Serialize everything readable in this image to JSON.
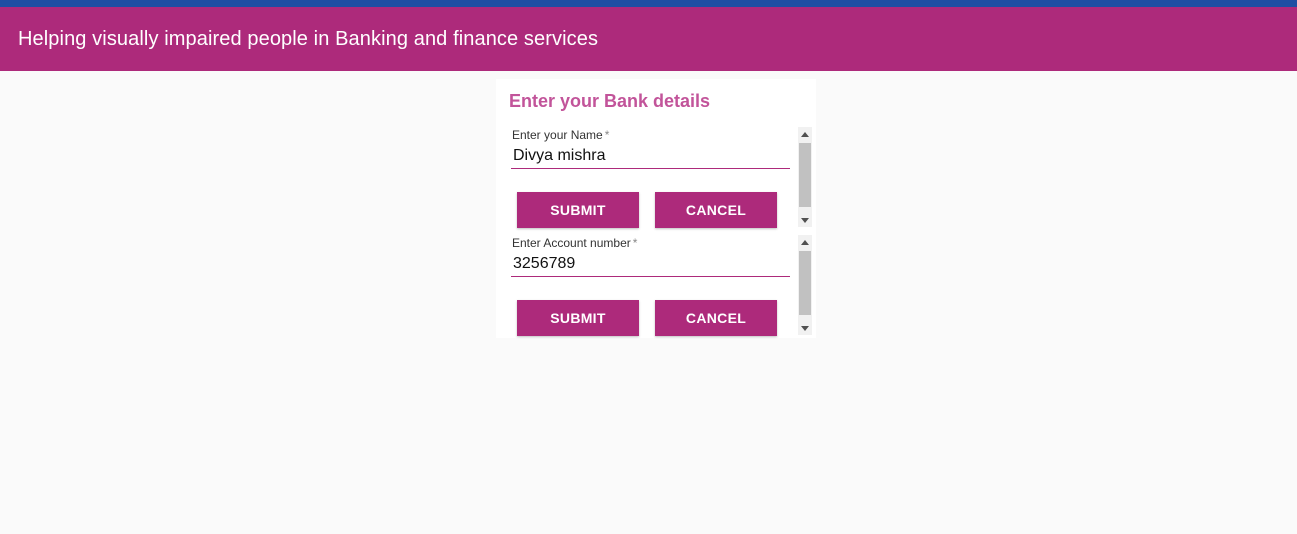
{
  "app": {
    "title": "Helping visually impaired people in Banking and finance services"
  },
  "form": {
    "heading": "Enter your Bank details",
    "name_field": {
      "label": "Enter your Name",
      "required_mark": "*",
      "value": "Divya mishra",
      "submit_label": "SUBMIT",
      "cancel_label": "CANCEL"
    },
    "account_field": {
      "label": "Enter Account number",
      "required_mark": "*",
      "value": "3256789",
      "submit_label": "SUBMIT",
      "cancel_label": "CANCEL"
    }
  },
  "icons": {
    "scroll_up": "triangle-up-icon",
    "scroll_down": "triangle-down-icon"
  },
  "colors": {
    "brand": "#ad2a7b",
    "top_strip": "#1f4ea3",
    "heading": "#c2549a",
    "background": "#fafafa"
  }
}
